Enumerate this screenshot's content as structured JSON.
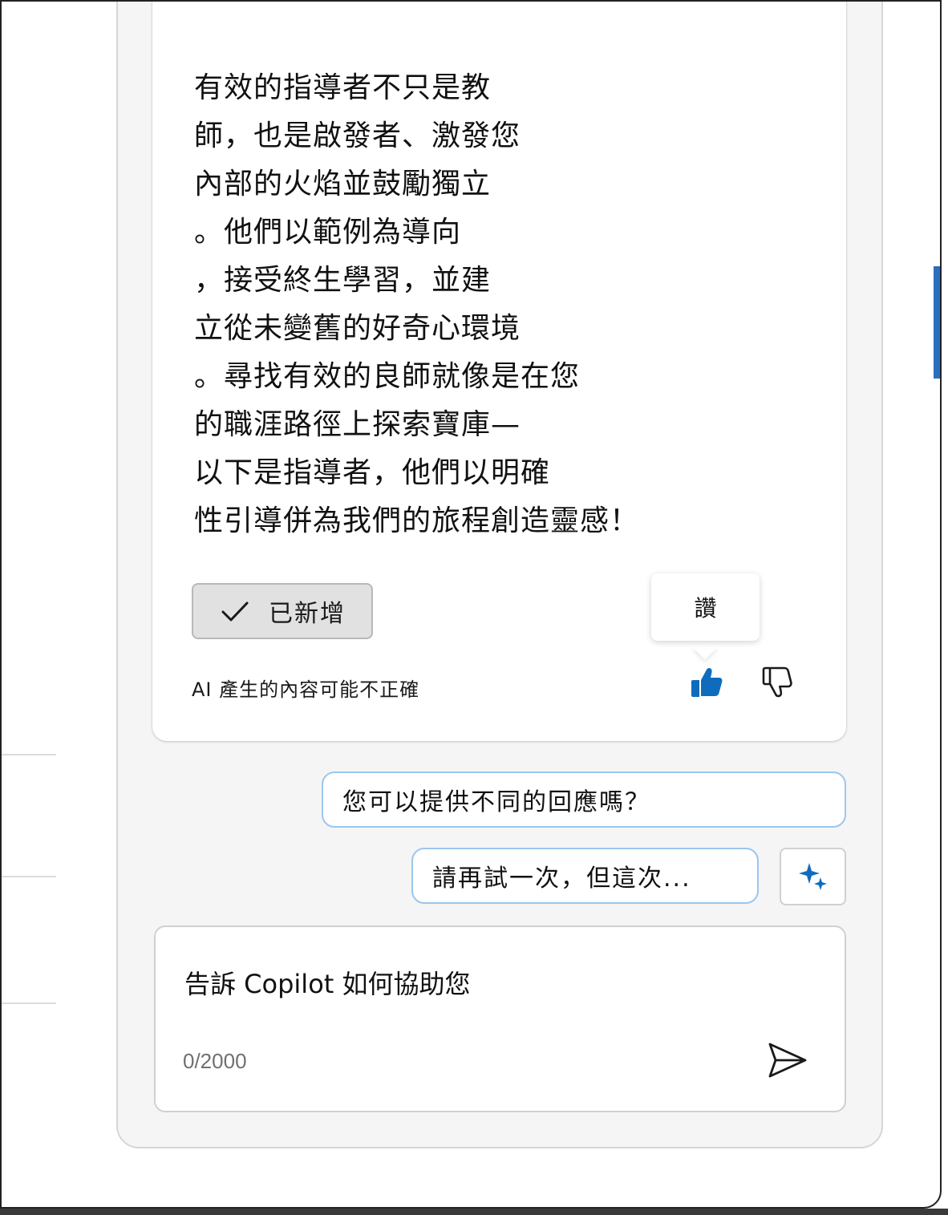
{
  "message": {
    "lines": [
      "有效的指導者不只是教",
      "師，也是啟發者、激發您",
      "內部的火焰並鼓勵獨立",
      "。他們以範例為導向",
      "，接受終生學習，並建",
      "立從未變舊的好奇心環境",
      "。尋找有效的良師就像是在您",
      "的職涯路徑上探索寶庫—",
      "以下是指導者，他們以明確",
      "性引導併為我們的旅程創造靈感！"
    ],
    "added_button_label": "已新增",
    "disclaimer": "AI 產生的內容可能不正確",
    "tooltip": "讚"
  },
  "suggestions": [
    "您可以提供不同的回應嗎？",
    "請再試一次，但這次..."
  ],
  "composer": {
    "placeholder": "告訴 Copilot 如何協助您",
    "char_count": "0/2000"
  },
  "colors": {
    "accent": "#0f6cbd",
    "suggestion_border": "#9ac6ee"
  },
  "icons": [
    "check-icon",
    "thumbs-up-icon",
    "thumbs-down-icon",
    "sparkle-icon",
    "send-icon"
  ]
}
